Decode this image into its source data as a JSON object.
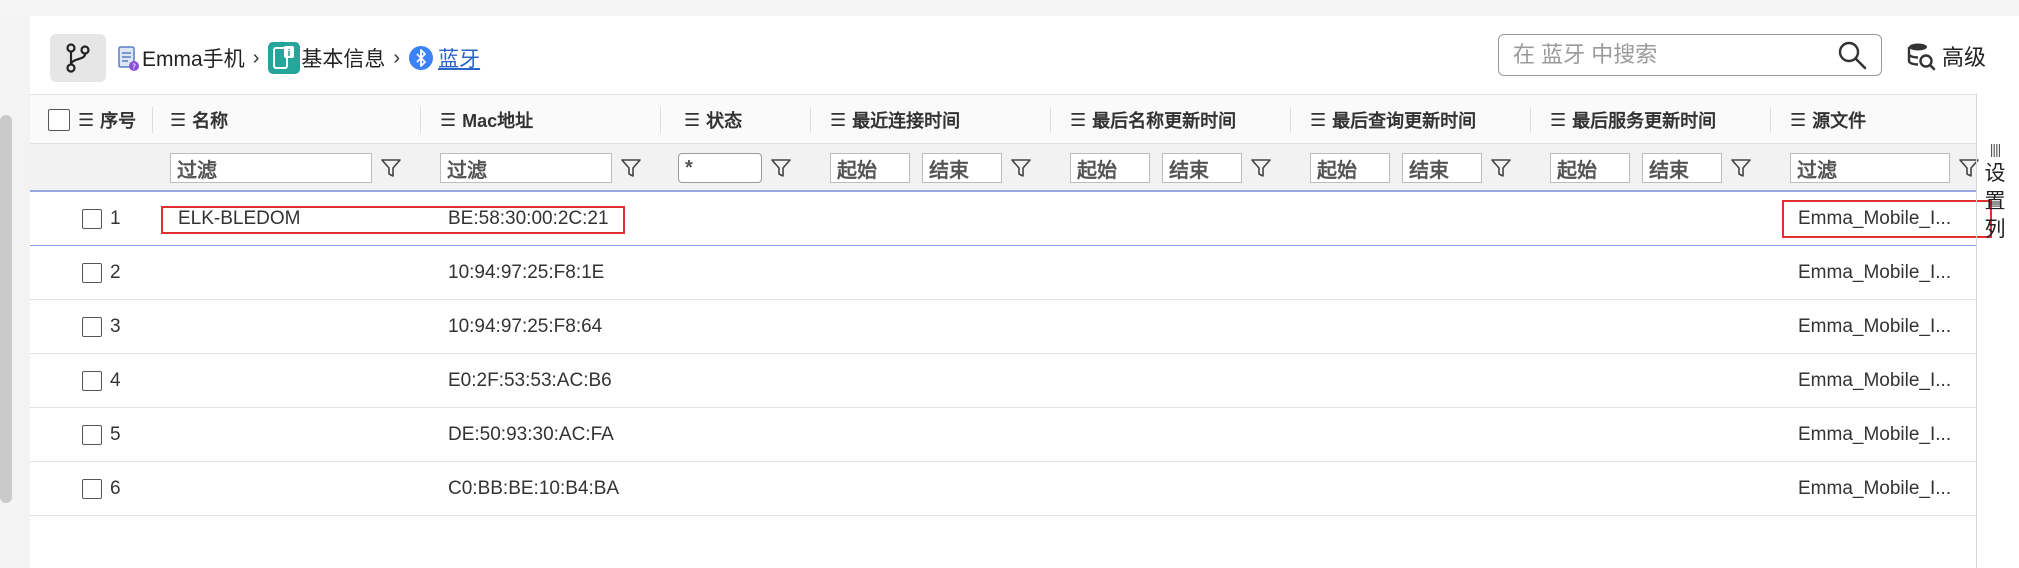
{
  "breadcrumb": {
    "device": "Emma手机",
    "category": "基本信息",
    "current": "蓝牙"
  },
  "search": {
    "placeholder": "在 蓝牙 中搜索"
  },
  "advanced_label": "高级",
  "columns": {
    "seq": "序号",
    "name": "名称",
    "mac": "Mac地址",
    "status": "状态",
    "last_connect": "最近连接时间",
    "last_name_update": "最后名称更新时间",
    "last_query_update": "最后查询更新时间",
    "last_service_update": "最后服务更新时间",
    "source": "源文件"
  },
  "filters": {
    "filter_placeholder": "过滤",
    "status_value": "*",
    "start": "起始",
    "end": "结束"
  },
  "rows": [
    {
      "num": "1",
      "name": "ELK-BLEDOM",
      "mac": "BE:58:30:00:2C:21",
      "source": "Emma_Mobile_I..."
    },
    {
      "num": "2",
      "name": "",
      "mac": "10:94:97:25:F8:1E",
      "source": "Emma_Mobile_I..."
    },
    {
      "num": "3",
      "name": "",
      "mac": "10:94:97:25:F8:64",
      "source": "Emma_Mobile_I..."
    },
    {
      "num": "4",
      "name": "",
      "mac": "E0:2F:53:53:AC:B6",
      "source": "Emma_Mobile_I..."
    },
    {
      "num": "5",
      "name": "",
      "mac": "DE:50:93:30:AC:FA",
      "source": "Emma_Mobile_I..."
    },
    {
      "num": "6",
      "name": "",
      "mac": "C0:BB:BE:10:B4:BA",
      "source": "Emma_Mobile_I..."
    }
  ],
  "settings_column": {
    "c1": "设",
    "c2": "置",
    "c3": "列"
  },
  "colors": {
    "accent": "#2a65c8",
    "highlight": "#e03030",
    "row_divider": "#8f9fe6",
    "bt_badge": "#3b82f6",
    "info_badge": "#26a69a"
  }
}
